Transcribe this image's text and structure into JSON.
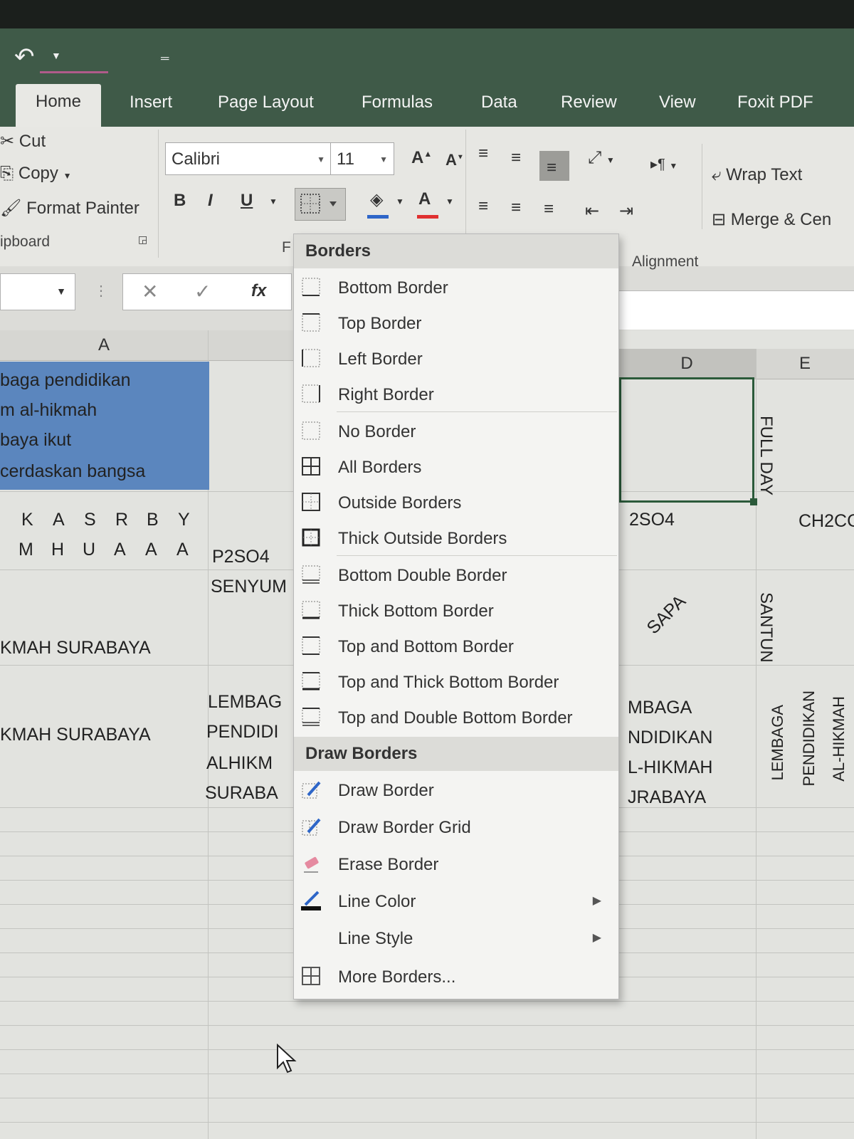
{
  "ribbon_tabs": [
    "Home",
    "Insert",
    "Page Layout",
    "Formulas",
    "Data",
    "Review",
    "View",
    "Foxit PDF"
  ],
  "clipboard": {
    "cut": "Cut",
    "copy": "Copy",
    "format_painter": "Format Painter",
    "group": "ipboard"
  },
  "font": {
    "name": "Calibri",
    "size": "11",
    "bold": "B",
    "italic": "I",
    "underline": "U",
    "group_fragment": "F"
  },
  "alignment": {
    "wrap_text": "Wrap Text",
    "merge": "Merge & Cen",
    "group": "Alignment"
  },
  "formula_bar": {
    "fx": "fx",
    "cancel": "✕",
    "enter": "✓"
  },
  "columns": {
    "a": "A",
    "d": "D",
    "e": "E"
  },
  "cells": {
    "a1_line1": "baga pendidikan",
    "a1_line2": "m al-hikmah",
    "a1_line3": "baya ikut",
    "a1_line4": "cerdaskan bangsa",
    "a2_letters_top": [
      "K",
      "A",
      "S",
      "R",
      "B",
      "Y"
    ],
    "a2_letters_bottom": [
      "M",
      "H",
      "U",
      "A",
      "A",
      "A"
    ],
    "b2": "P2SO4",
    "b3": "SENYUM",
    "a3": "KMAH SURABAYA",
    "b4_1": "LEMBAG",
    "b4_2": "PENDIDI",
    "b4_3": "ALHIKM",
    "b4_4": "SURABA",
    "a4": "KMAH SURABAYA",
    "d2": "2SO4",
    "e2": "CH2CC",
    "d3": "SAPA",
    "d4_1": "MBAGA",
    "d4_2": "NDIDIKAN",
    "d4_3": "L-HIKMAH",
    "d4_4": "JRABAYA",
    "e1": "FULL DAY",
    "e3": "SANTUN",
    "e4_1": "LEMBAGA",
    "e4_2": "PENDIDIKAN",
    "e4_3": "AL-HIKMAH"
  },
  "menu": {
    "borders_header": "Borders",
    "borders": [
      {
        "label": "Bottom Border",
        "icon": "bottom-border-icon"
      },
      {
        "label": "Top Border",
        "icon": "top-border-icon"
      },
      {
        "label": "Left Border",
        "icon": "left-border-icon"
      },
      {
        "label": "Right Border",
        "icon": "right-border-icon"
      },
      {
        "label": "No Border",
        "icon": "no-border-icon"
      },
      {
        "label": "All Borders",
        "icon": "all-borders-icon"
      },
      {
        "label": "Outside Borders",
        "icon": "outside-borders-icon"
      },
      {
        "label": "Thick Outside Borders",
        "icon": "thick-outside-borders-icon"
      },
      {
        "label": "Bottom Double Border",
        "icon": "bottom-double-border-icon"
      },
      {
        "label": "Thick Bottom Border",
        "icon": "thick-bottom-border-icon"
      },
      {
        "label": "Top and Bottom Border",
        "icon": "top-and-bottom-border-icon"
      },
      {
        "label": "Top and Thick Bottom Border",
        "icon": "top-and-thick-bottom-border-icon"
      },
      {
        "label": "Top and Double Bottom Border",
        "icon": "top-and-double-bottom-border-icon"
      }
    ],
    "draw_header": "Draw Borders",
    "draw": [
      {
        "label": "Draw Border",
        "icon": "draw-border-icon"
      },
      {
        "label": "Draw Border Grid",
        "icon": "draw-border-grid-icon"
      },
      {
        "label": "Erase Border",
        "icon": "eraser-icon"
      },
      {
        "label": "Line Color",
        "icon": "line-color-icon"
      },
      {
        "label": "Line Style",
        "icon": "line-style-icon"
      },
      {
        "label": "More Borders...",
        "icon": "more-borders-icon"
      }
    ]
  },
  "colors": {
    "titlebar": "#3f5a48",
    "selection": "#5b86be",
    "font_color": "#e03030"
  }
}
